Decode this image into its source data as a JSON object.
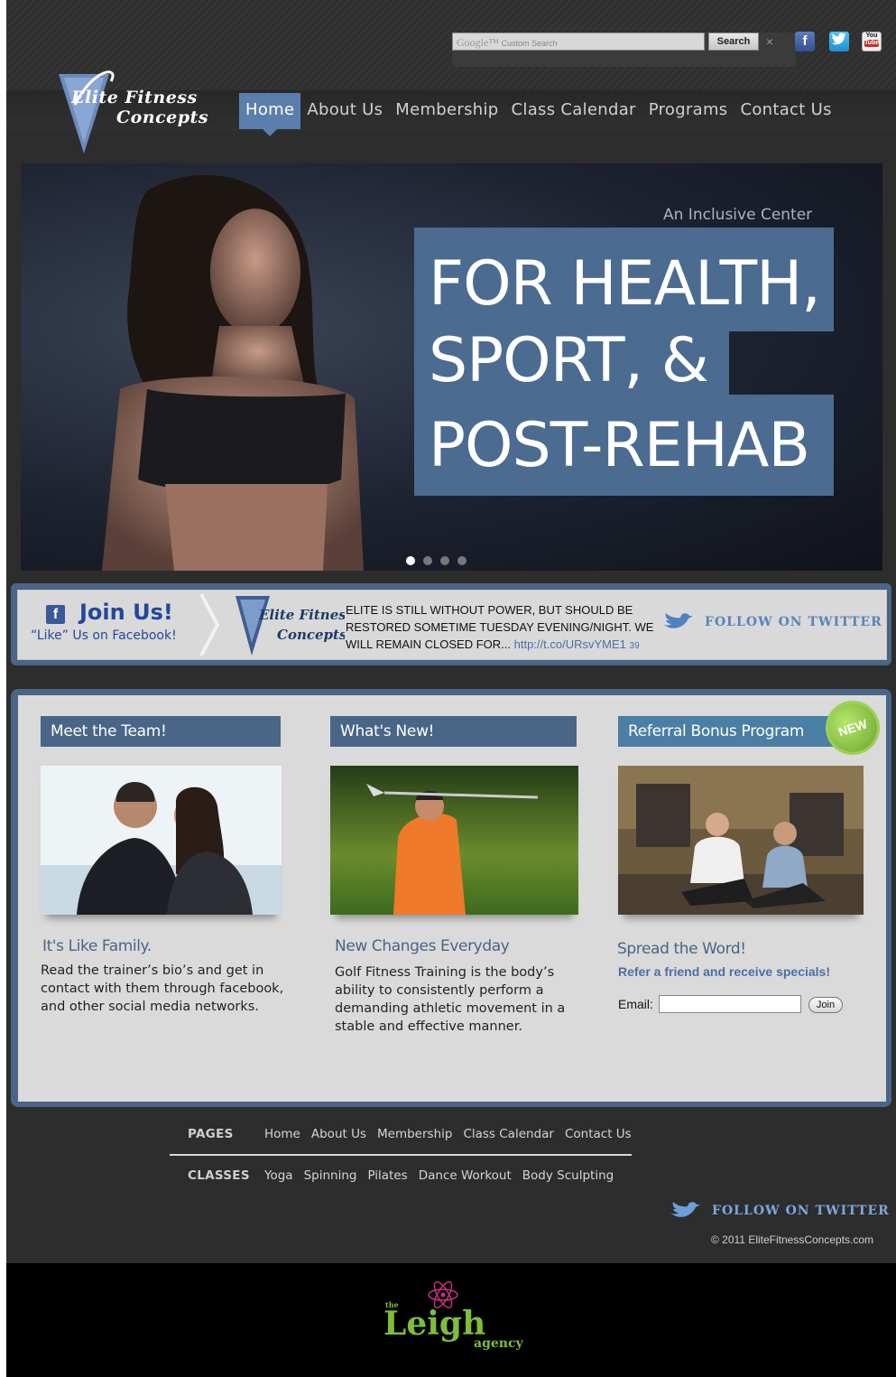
{
  "search": {
    "placeholder_brand": "Google™",
    "placeholder": "Custom Search",
    "button": "Search",
    "clear": "×"
  },
  "social": {
    "facebook": "f",
    "twitter": "t",
    "youtube_top": "You",
    "youtube_bottom": "Tube"
  },
  "logo": {
    "line1": "Elite Fitness",
    "line2": "Concepts"
  },
  "nav": {
    "items": [
      "Home",
      "About Us",
      "Membership",
      "Class Calendar",
      "Programs",
      "Contact Us"
    ],
    "active": "Home"
  },
  "hero": {
    "kicker": "An Inclusive Center",
    "line1": "FOR HEALTH,",
    "line2": "SPORT, &",
    "line3": "POST-REHAB",
    "slides": 4,
    "active_slide": 1
  },
  "strip": {
    "join_title": "Join Us!",
    "join_sub": "“Like” Us on Facebook!",
    "news": "ELITE IS STILL WITHOUT POWER, BUT SHOULD BE RESTORED SOMETIME TUESDAY EVENING/NIGHT. WE WILL REMAIN CLOSED FOR...",
    "news_link": "http://t.co/URsvYME1",
    "news_count": "39",
    "follow": "FOLLOW ON TWITTER"
  },
  "columns": [
    {
      "heading": "Meet the Team!",
      "subtitle": "It's Like Family.",
      "body": "Read the trainer’s bio’s and get in contact with them through facebook, and other social media networks."
    },
    {
      "heading": "What's New!",
      "subtitle": "New Changes Everyday",
      "body": "Golf Fitness Training is the body’s ability to consistently perform a demanding athletic movement in a stable and effective manner."
    },
    {
      "heading": "Referral Bonus Program",
      "badge": "NEW",
      "subtitle": "Spread the Word!",
      "body": "Refer a friend and receive specials!",
      "email_label": "Email:",
      "email_value": "",
      "join": "Join"
    }
  ],
  "footer": {
    "pages_label": "PAGES",
    "pages": [
      "Home",
      "About Us",
      "Membership",
      "Class Calendar",
      "Contact Us"
    ],
    "classes_label": "CLASSES",
    "classes": [
      "Yoga",
      "Spinning",
      "Pilates",
      "Dance Workout",
      "Body Sculpting"
    ],
    "follow": "FOLLOW ON TWITTER",
    "copyright": "© 2011 EliteFitnessConcepts.com"
  },
  "agency": {
    "the": "the",
    "name": "Leigh",
    "suffix": "agency"
  },
  "colors": {
    "accent": "#4a6586",
    "nav_active": "#5a7fad",
    "link": "#4a6fa5",
    "badge": "#7dbb3a"
  }
}
